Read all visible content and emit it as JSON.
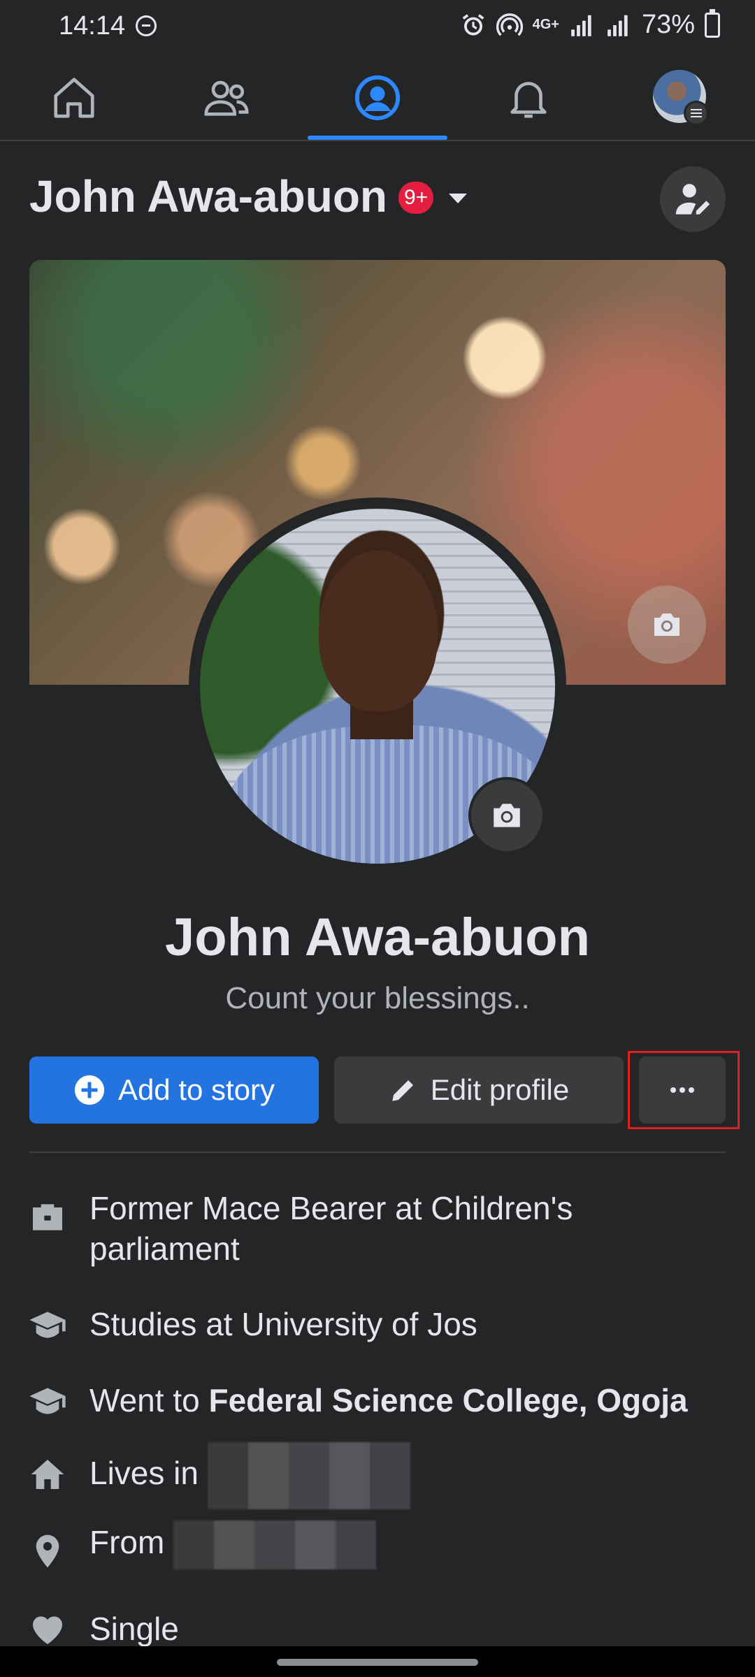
{
  "status_bar": {
    "time": "14:14",
    "network": "4G+",
    "battery": "73%"
  },
  "nav": {
    "items": [
      "home",
      "friends",
      "profile",
      "notifications",
      "menu"
    ],
    "active": "profile",
    "accent_color": "#2d88ff"
  },
  "header": {
    "name": "John Awa-abuon",
    "badge": "9+"
  },
  "profile": {
    "name": "John Awa-abuon",
    "bio": "Count your blessings.."
  },
  "actions": {
    "add_story": "Add to story",
    "edit_profile": "Edit profile",
    "more": "···"
  },
  "details": {
    "work": "Former Mace Bearer at Children's parliament",
    "studies": "Studies at University of Jos",
    "went_to_prefix": "Went to ",
    "went_to_school": "Federal Science College, Ogoja",
    "lives_in_prefix": "Lives in ",
    "from_prefix": "From ",
    "relationship": "Single"
  },
  "colors": {
    "background": "#242526",
    "primary_button": "#2374e1",
    "secondary_button": "#3a3b3c",
    "badge": "#e41e3f",
    "highlight_box": "#e02020"
  }
}
